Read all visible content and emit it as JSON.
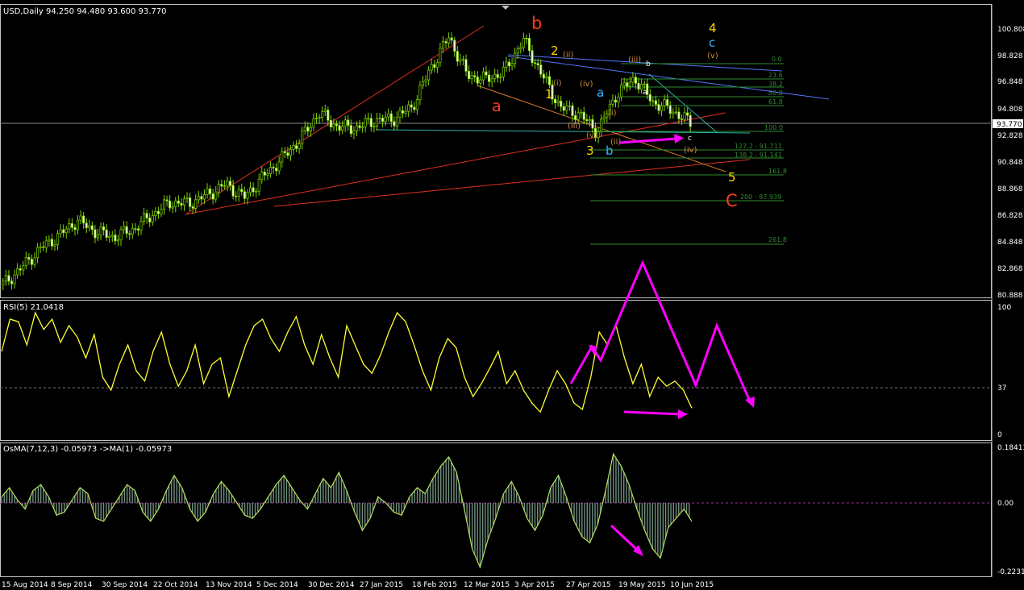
{
  "colors": {
    "background": "#000000",
    "panel_border": "#c0c0c0",
    "candle": "#7fd400",
    "rsi_line": "#ffff33",
    "osma_line": "#b8e05a",
    "osma_hist": "#6f8f7f",
    "pink": "#ff00ff",
    "red_wave": "#ff3b1f",
    "yellow_wave": "#ffd700",
    "cyan_wave": "#33b5ff",
    "orange_wave": "#d28a3c",
    "fib": "#2e8b2e",
    "trend_red": "#e03020",
    "trend_orange": "#d47a2a",
    "trend_blue": "#5577ff",
    "support_line": "#2db4a8",
    "text": "#ffffff"
  },
  "price_panel": {
    "title": "USD,Daily  94.250 94.480 93.600 93.770",
    "current_price_label": "93.770",
    "y_labels": [
      "100.808",
      "98.828",
      "96.848",
      "94.808",
      "92.828",
      "90.848",
      "88.868",
      "86.828",
      "84.848",
      "82.868",
      "80.888"
    ]
  },
  "rsi_panel": {
    "title": "RSI(5) 21.0418",
    "y_labels": [
      "100",
      "37",
      "0"
    ]
  },
  "osma_panel": {
    "title": "OsMA(7,12,3) -0.05973  ->MA(1) -0.05973",
    "y_labels": [
      "0.18413",
      "0.00",
      "-0.22312"
    ]
  },
  "x_axis_labels": [
    "15 Aug 2014",
    "8 Sep 2014",
    "30 Sep 2014",
    "22 Oct 2014",
    "13 Nov 2014",
    "5 Dec 2014",
    "30 Dec 2014",
    "27 Jan 2015",
    "18 Feb 2015",
    "12 Mar 2015",
    "3 Apr 2015",
    "27 Apr 2015",
    "19 May 2015",
    "10 Jun 2015"
  ],
  "wave_labels": {
    "a_red": "a",
    "b_red": "b",
    "C_red": "C",
    "w1": "1",
    "w2": "2",
    "w3": "3",
    "w4": "4",
    "w5": "5",
    "cyan_a": "a",
    "cyan_b": "b",
    "cyan_c": "c",
    "o_i": "(i)",
    "o_ii": "(ii)",
    "o_iii": "(iii)",
    "o_iv": "(iv)",
    "o_v": "(v)",
    "m_i": "(i)",
    "m_ii": "(ii)",
    "m_iii": "(iii)",
    "m_iv": "(iv)",
    "m_v": "(v)",
    "small_a": "a",
    "small_b": "b",
    "small_c": "c"
  },
  "fib_labels": [
    "0.0",
    "23.6",
    "38.2",
    "50.0",
    "61.8",
    "100.0",
    "127.2 - 91.711",
    "138.2 - 91.141",
    "161.8",
    "200 - 87.939",
    "261.8"
  ],
  "chart_data": {
    "type": "candlestick",
    "symbol": "USD",
    "timeframe": "Daily",
    "ohlc_last": {
      "open": 94.25,
      "high": 94.48,
      "low": 93.6,
      "close": 93.77
    },
    "ylim": [
      80.0,
      102.0
    ],
    "close_path": [
      [
        "15 Aug 2014",
        81.2
      ],
      [
        "1 Sep 2014",
        82.5
      ],
      [
        "8 Sep 2014",
        84.0
      ],
      [
        "18 Sep 2014",
        85.0
      ],
      [
        "30 Sep 2014",
        86.2
      ],
      [
        "8 Oct 2014",
        85.3
      ],
      [
        "15 Oct 2014",
        84.9
      ],
      [
        "22 Oct 2014",
        85.5
      ],
      [
        "29 Oct 2014",
        86.6
      ],
      [
        "5 Nov 2014",
        87.6
      ],
      [
        "13 Nov 2014",
        87.5
      ],
      [
        "25 Nov 2014",
        88.2
      ],
      [
        "5 Dec 2014",
        89.0
      ],
      [
        "15 Dec 2014",
        88.0
      ],
      [
        "23 Dec 2014",
        89.6
      ],
      [
        "30 Dec 2014",
        91.0
      ],
      [
        "7 Jan 2015",
        92.5
      ],
      [
        "14 Jan 2015",
        94.6
      ],
      [
        "21 Jan 2015",
        93.5
      ],
      [
        "27 Jan 2015",
        93.4
      ],
      [
        "5 Feb 2015",
        94.0
      ],
      [
        "18 Feb 2015",
        94.1
      ],
      [
        "25 Feb 2015",
        95.0
      ],
      [
        "5 Mar 2015",
        98.0
      ],
      [
        "13 Mar 2015",
        100.5
      ],
      [
        "19 Mar 2015",
        97.5
      ],
      [
        "26 Mar 2015",
        97.2
      ],
      [
        "3 Apr 2015",
        97.8
      ],
      [
        "13 Apr 2015",
        100.3
      ],
      [
        "20 Apr 2015",
        97.6
      ],
      [
        "27 Apr 2015",
        95.0
      ],
      [
        "5 May 2015",
        94.5
      ],
      [
        "14 May 2015",
        93.1
      ],
      [
        "19 May 2015",
        96.0
      ],
      [
        "27 May 2015",
        97.3
      ],
      [
        "3 Jun 2015",
        95.4
      ],
      [
        "10 Jun 2015",
        94.8
      ],
      [
        "15 Jun 2015",
        93.8
      ]
    ],
    "fibonacci_levels": [
      "0.0",
      "23.6",
      "38.2",
      "50.0",
      "61.8",
      "100.0",
      "127.2 - 91.711",
      "138.2 - 91.141",
      "161.8",
      "200 - 87.939",
      "261.8"
    ],
    "rsi": {
      "name": "RSI(5)",
      "last": 21.0418,
      "levels": [
        100,
        37,
        0
      ],
      "values": [
        65,
        90,
        88,
        70,
        95,
        82,
        90,
        72,
        85,
        76,
        60,
        78,
        45,
        35,
        55,
        70,
        50,
        42,
        65,
        80,
        55,
        38,
        50,
        70,
        40,
        55,
        60,
        30,
        50,
        70,
        85,
        90,
        75,
        65,
        80,
        92,
        70,
        55,
        78,
        60,
        45,
        85,
        70,
        55,
        48,
        62,
        80,
        95,
        88,
        70,
        50,
        35,
        60,
        75,
        68,
        45,
        30,
        40,
        52,
        65,
        40,
        50,
        35,
        25,
        18,
        35,
        50,
        40,
        25,
        20,
        45,
        80,
        70,
        85,
        60,
        40,
        55,
        30,
        45,
        38,
        42,
        35,
        21
      ]
    },
    "osma": {
      "name": "OsMA(7,12,3)",
      "last": -0.05973,
      "ylim": [
        -0.22312,
        0.18413
      ],
      "values": [
        0.02,
        0.05,
        0.01,
        -0.02,
        0.04,
        0.06,
        0.02,
        -0.04,
        -0.03,
        0.01,
        0.05,
        0.03,
        -0.05,
        -0.06,
        -0.02,
        0.02,
        0.06,
        0.04,
        -0.03,
        -0.06,
        -0.02,
        0.04,
        0.09,
        0.05,
        -0.02,
        -0.06,
        -0.03,
        0.03,
        0.07,
        0.04,
        0.0,
        -0.04,
        -0.05,
        -0.02,
        0.02,
        0.06,
        0.09,
        0.05,
        0.01,
        -0.02,
        0.03,
        0.08,
        0.05,
        0.1,
        0.04,
        -0.03,
        -0.09,
        -0.05,
        0.02,
        0.0,
        -0.03,
        -0.04,
        0.02,
        0.05,
        0.03,
        0.08,
        0.12,
        0.15,
        0.1,
        -0.02,
        -0.15,
        -0.21,
        -0.12,
        -0.05,
        0.03,
        0.07,
        0.02,
        -0.05,
        -0.09,
        -0.04,
        0.05,
        0.09,
        0.02,
        -0.06,
        -0.11,
        -0.13,
        -0.07,
        0.04,
        0.16,
        0.12,
        0.06,
        -0.02,
        -0.09,
        -0.15,
        -0.18,
        -0.08,
        -0.05,
        -0.02,
        -0.06
      ]
    }
  }
}
